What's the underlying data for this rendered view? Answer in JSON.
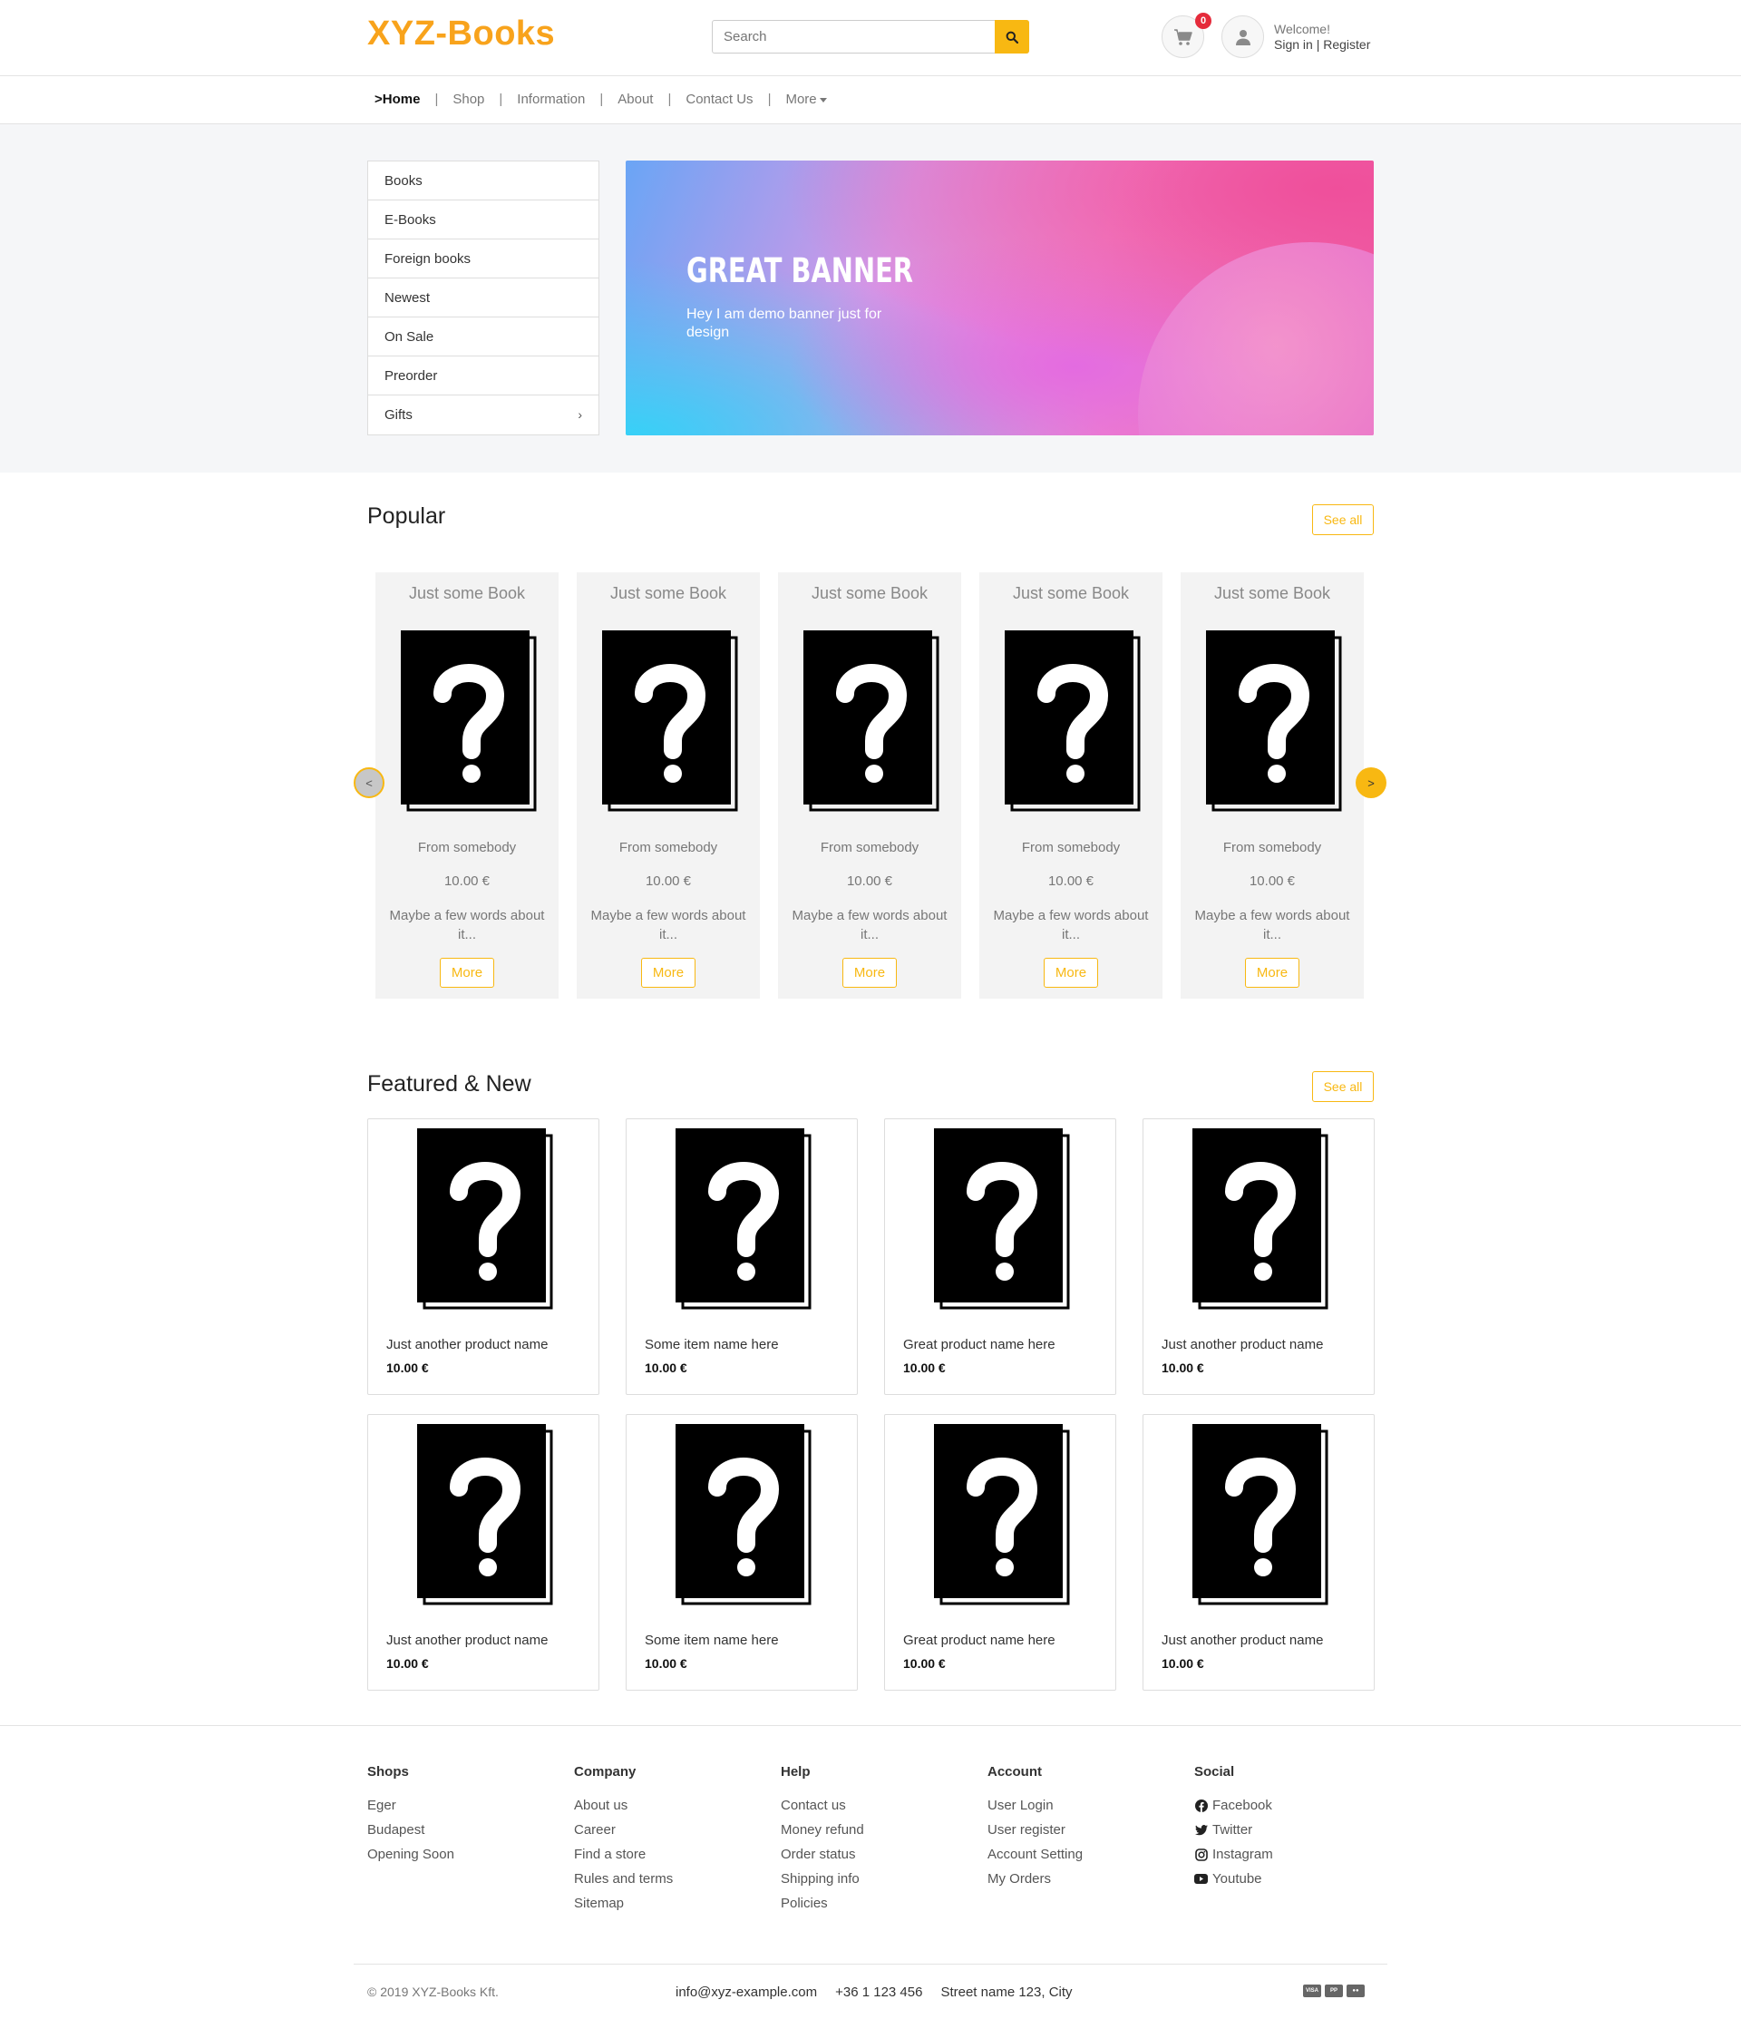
{
  "header": {
    "logo": "XYZ-Books",
    "search_placeholder": "Search",
    "cart_count": "0",
    "welcome": "Welcome!",
    "sign_in": "Sign in",
    "separator": " | ",
    "register": "Register"
  },
  "nav": {
    "items": [
      {
        "label": ">Home",
        "active": true
      },
      {
        "label": "Shop"
      },
      {
        "label": "Information"
      },
      {
        "label": "About"
      },
      {
        "label": "Contact Us"
      },
      {
        "label": "More"
      }
    ],
    "separator": "|"
  },
  "categories": [
    "Books",
    "E-Books",
    "Foreign books",
    "Newest",
    "On Sale",
    "Preorder",
    "Gifts"
  ],
  "banner": {
    "title": "GREAT BANNER",
    "subtitle": "Hey I am demo banner just for design"
  },
  "popular": {
    "title": "Popular",
    "see_all": "See all",
    "prev": "<",
    "next": ">",
    "items": [
      {
        "title": "Just some Book",
        "author": "From somebody",
        "price": "10.00 €",
        "desc": "Maybe a few words about it...",
        "button": "More"
      },
      {
        "title": "Just some Book",
        "author": "From somebody",
        "price": "10.00 €",
        "desc": "Maybe a few words about it...",
        "button": "More"
      },
      {
        "title": "Just some Book",
        "author": "From somebody",
        "price": "10.00 €",
        "desc": "Maybe a few words about it...",
        "button": "More"
      },
      {
        "title": "Just some Book",
        "author": "From somebody",
        "price": "10.00 €",
        "desc": "Maybe a few words about it...",
        "button": "More"
      },
      {
        "title": "Just some Book",
        "author": "From somebody",
        "price": "10.00 €",
        "desc": "Maybe a few words about it...",
        "button": "More"
      }
    ]
  },
  "featured": {
    "title": "Featured & New",
    "see_all": "See all",
    "items": [
      {
        "name": "Just another product name",
        "price": "10.00 €"
      },
      {
        "name": "Some item name here",
        "price": "10.00 €"
      },
      {
        "name": "Great product name here",
        "price": "10.00 €"
      },
      {
        "name": "Just another product name",
        "price": "10.00 €"
      },
      {
        "name": "Just another product name",
        "price": "10.00 €"
      },
      {
        "name": "Some item name here",
        "price": "10.00 €"
      },
      {
        "name": "Great product name here",
        "price": "10.00 €"
      },
      {
        "name": "Just another product name",
        "price": "10.00 €"
      }
    ]
  },
  "footer": {
    "columns": [
      {
        "heading": "Shops",
        "links": [
          "Eger",
          "Budapest",
          "Opening Soon"
        ]
      },
      {
        "heading": "Company",
        "links": [
          "About us",
          "Career",
          "Find a store",
          "Rules and terms",
          "Sitemap"
        ]
      },
      {
        "heading": "Help",
        "links": [
          "Contact us",
          "Money refund",
          "Order status",
          "Shipping info",
          "Policies"
        ]
      },
      {
        "heading": "Account",
        "links": [
          "User Login",
          "User register",
          "Account Setting",
          "My Orders"
        ]
      },
      {
        "heading": "Social",
        "links": [
          "Facebook",
          "Twitter",
          "Instagram",
          "Youtube"
        ]
      }
    ],
    "copyright": "© 2019 XYZ-Books Kft.",
    "email": "info@xyz-example.com",
    "phone": "+36 1 123 456",
    "address": "Street name 123, City",
    "payment_icons": [
      "visa-icon",
      "paypal-icon",
      "mastercard-icon"
    ]
  },
  "colors": {
    "accent": "#f8b812",
    "logo": "#f8a31c",
    "badge": "#e52b3b"
  }
}
